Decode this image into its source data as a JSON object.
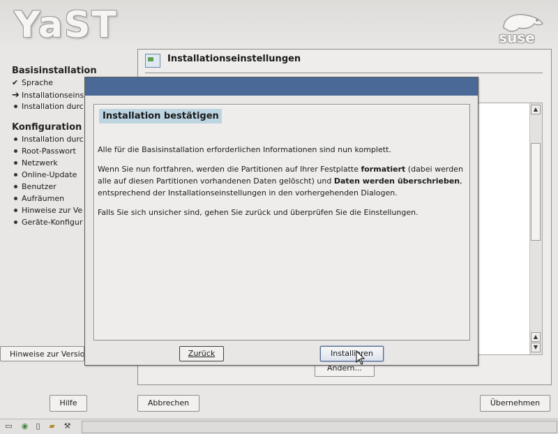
{
  "header": {
    "logo_text": "YaST",
    "brand_logo_text": "suse"
  },
  "sidebar": {
    "section1": "Basisinstallation",
    "items1": [
      {
        "label": "Sprache",
        "state": "done"
      },
      {
        "label": "Installationseins",
        "state": "current"
      },
      {
        "label": "Installation durc",
        "state": "pending"
      }
    ],
    "section2": "Konfiguration",
    "items2": [
      {
        "label": "Installation durc"
      },
      {
        "label": "Root-Passwort"
      },
      {
        "label": "Netzwerk"
      },
      {
        "label": "Online-Update"
      },
      {
        "label": "Benutzer"
      },
      {
        "label": "Aufräumen"
      },
      {
        "label": "Hinweise zur Ve"
      },
      {
        "label": "Geräte-Konfigur"
      }
    ],
    "release_notes_button": "Hinweise zur Versio"
  },
  "main": {
    "title": "Installationseinstellungen",
    "change_button": "Ändern..."
  },
  "dialog": {
    "heading": "Installation bestätigen",
    "para1": "Alle für die Basisinstallation erforderlichen Informationen sind nun komplett.",
    "para2_a": "Wenn Sie nun fortfahren, werden die Partitionen auf Ihrer Festplatte ",
    "para2_b": "formatiert",
    "para2_c": " (dabei werden alle auf diesen Partitionen vorhandenen Daten gelöscht) und ",
    "para2_d": "Daten werden überschrieben",
    "para2_e": ", entsprechend der Installationseinstellungen in den vorhergehenden Dialogen.",
    "para3": "Falls Sie sich unsicher sind, gehen Sie zurück und überprüfen Sie die Einstellungen.",
    "back_button": "Zurück",
    "install_button": "Installieren"
  },
  "footer": {
    "help_button": "Hilfe",
    "abort_button": "Abbrechen",
    "accept_button": "Übernehmen"
  }
}
